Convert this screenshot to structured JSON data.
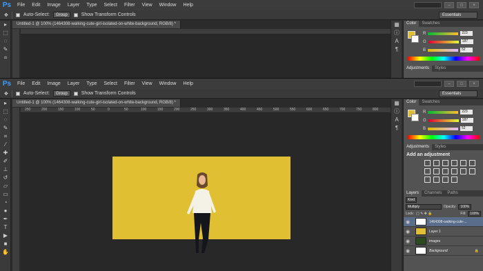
{
  "app": {
    "logo": "Ps",
    "icon": "photoshop-logo"
  },
  "menu": [
    "File",
    "Edit",
    "Image",
    "Layer",
    "Type",
    "Select",
    "Filter",
    "View",
    "Window",
    "Help"
  ],
  "options": {
    "auto_select_label": "Auto-Select:",
    "auto_select_value": "Group",
    "transform_label": "Show Transform Controls",
    "workspace": "Essentials"
  },
  "document": {
    "tab_title": "Untitled-1 @ 100% (1464308-walking-cute-girl-isolated-on-white-background, RGB/8) *",
    "ruler_ticks": [
      "250",
      "200",
      "150",
      "100",
      "50",
      "0",
      "50",
      "100",
      "150",
      "200",
      "250",
      "300",
      "350",
      "400",
      "450",
      "500",
      "550",
      "600",
      "650",
      "700",
      "750",
      "800"
    ],
    "fill_color": "#e0c032"
  },
  "color_panel": {
    "tabs": [
      "Color",
      "Swatches"
    ],
    "channels": [
      {
        "label": "R",
        "value": "223"
      },
      {
        "label": "G",
        "value": "187"
      },
      {
        "label": "B",
        "value": "52"
      }
    ]
  },
  "adjustments_panel": {
    "tabs": [
      "Adjustments",
      "Styles"
    ],
    "title": "Add an adjustment"
  },
  "layers_panel": {
    "tabs": [
      "Layers",
      "Channels",
      "Paths"
    ],
    "filter": "Kind",
    "blend_mode": "Multiply",
    "opacity_label": "Opacity:",
    "opacity_value": "100%",
    "lock_label": "Lock:",
    "fill_label": "Fill:",
    "fill_value": "100%",
    "layers": [
      {
        "name": "1464308-walking-cute-...",
        "thumb": "#ffffff",
        "selected": true
      },
      {
        "name": "Layer 1",
        "thumb": "#e0c032",
        "selected": false
      },
      {
        "name": "images",
        "thumb": "#2c4a20",
        "selected": false
      },
      {
        "name": "Background",
        "thumb": "#ffffff",
        "selected": false
      }
    ]
  }
}
